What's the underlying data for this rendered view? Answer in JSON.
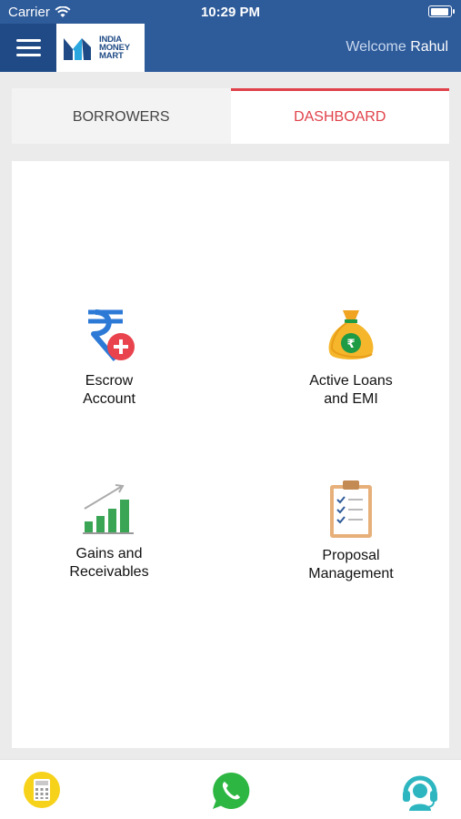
{
  "status": {
    "carrier": "Carrier",
    "time": "10:29 PM",
    "battery_level": 0.95
  },
  "header": {
    "logo_lines": [
      "INDIA",
      "MONEY",
      "MART"
    ],
    "welcome_label": "Welcome",
    "user_name": "Rahul"
  },
  "tabs": [
    {
      "label": "BORROWERS",
      "active": false
    },
    {
      "label": "DASHBOARD",
      "active": true
    }
  ],
  "dashboard": {
    "tiles": [
      {
        "label": "Escrow\nAccount",
        "icon": "rupee-plus-icon"
      },
      {
        "label": "Active Loans\nand EMI",
        "icon": "money-bag-icon"
      },
      {
        "label": "Gains and\nReceivables",
        "icon": "growth-chart-icon"
      },
      {
        "label": "Proposal\nManagement",
        "icon": "clipboard-checklist-icon"
      }
    ]
  },
  "bottom_bar": [
    {
      "icon": "calculator-icon"
    },
    {
      "icon": "whatsapp-icon"
    },
    {
      "icon": "support-headset-icon"
    }
  ],
  "colors": {
    "header_bg": "#2e5b9a",
    "accent_red": "#e0424a",
    "whatsapp_green": "#2db742",
    "calculator_yellow": "#f7d21a",
    "support_teal": "#2eb6c0"
  }
}
